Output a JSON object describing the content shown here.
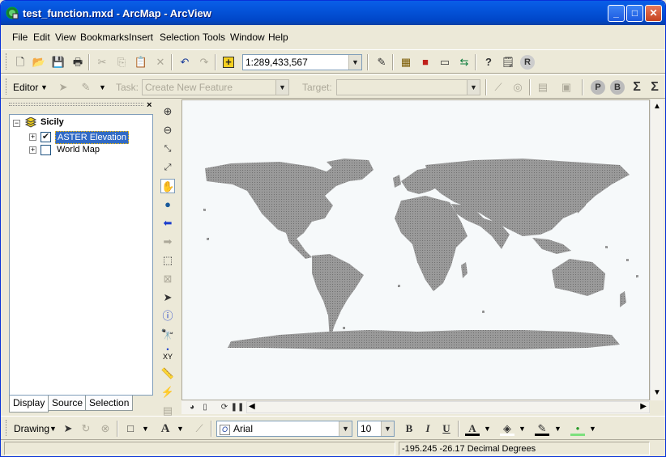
{
  "window": {
    "title": "test_function.mxd - ArcMap - ArcView",
    "minimize": "_",
    "maximize": "□",
    "close": "✕"
  },
  "menu": [
    {
      "label": "File"
    },
    {
      "label": "Edit"
    },
    {
      "label": "View"
    },
    {
      "label": "Bookmarks"
    },
    {
      "label": "Insert"
    },
    {
      "label": "Selection"
    },
    {
      "label": "Tools"
    },
    {
      "label": "Window"
    },
    {
      "label": "Help"
    }
  ],
  "standard_toolbar": {
    "scale": "1:289,433,567",
    "icons": [
      "new-document-icon",
      "open-folder-icon",
      "save-icon",
      "print-icon",
      "cut-icon",
      "copy-icon",
      "paste-icon",
      "delete-icon",
      "undo-icon",
      "redo-icon",
      "add-data-icon",
      "editor-toolbar-icon",
      "arccatalog-icon",
      "arctoolbox-icon",
      "command-line-icon",
      "model-builder-icon",
      "whats-this-icon",
      "help-identify-icon",
      "r-icon"
    ]
  },
  "editor_toolbar": {
    "editor_label": "Editor",
    "task_label": "Task:",
    "task_value": "Create New Feature",
    "target_label": "Target:",
    "target_value": "",
    "buttons": {
      "p": "P",
      "b": "B",
      "sigma": "Σ",
      "sigma2": "Σ"
    }
  },
  "toc": {
    "close": "×",
    "root": {
      "label": "Sicily",
      "expander": "−"
    },
    "layers": [
      {
        "label": "ASTER Elevation",
        "checked": true,
        "expander": "+",
        "selected": true
      },
      {
        "label": "World Map",
        "checked": false,
        "expander": "+",
        "selected": false
      }
    ],
    "tabs": [
      {
        "label": "Display"
      },
      {
        "label": "Source"
      },
      {
        "label": "Selection"
      }
    ]
  },
  "tools_icons": [
    "zoom-in-icon",
    "zoom-out-icon",
    "fixed-zoom-in-icon",
    "fixed-zoom-out-icon",
    "pan-icon",
    "full-extent-icon",
    "back-extent-icon",
    "forward-extent-icon",
    "select-features-icon",
    "clear-selection-icon",
    "select-elements-icon",
    "identify-icon",
    "find-icon",
    "go-to-xy-icon",
    "measure-icon",
    "hyperlink-icon",
    "html-popup-icon"
  ],
  "tools_xy_label": "XY",
  "drawing_toolbar": {
    "drawing_label": "Drawing",
    "font_name": "Arial",
    "font_size": "10",
    "bold": "B",
    "italic": "I",
    "underline": "U",
    "font_a": "A"
  },
  "status": {
    "coords": "-195.245  -26.17 Decimal Degrees"
  },
  "colors": {
    "title_blue": "#0453d9",
    "map_bg": "#f6f9fa",
    "land": "#8a8a8a",
    "selected": "#316ac5"
  }
}
